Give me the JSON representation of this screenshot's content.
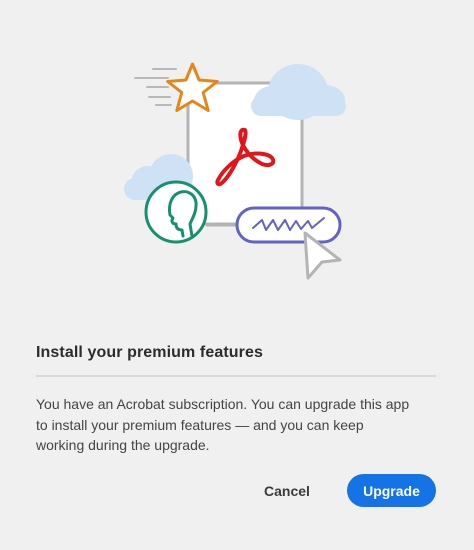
{
  "dialog": {
    "title": "Install your premium features",
    "body_lines": [
      "You have an Acrobat subscription. You can upgrade this app",
      "to install your premium features — and you can keep",
      "working during the upgrade."
    ],
    "cancel_label": "Cancel",
    "upgrade_label": "Upgrade"
  },
  "illustration": {
    "icons": [
      "star-icon",
      "cloud-icon",
      "acrobat-logo-icon",
      "profile-icon",
      "signature-field-icon",
      "cursor-icon"
    ]
  },
  "colors": {
    "background": "#f0f0f0",
    "accent": "#1473e6",
    "star": "#e68619",
    "acrobat_red": "#e0161b",
    "profile_green": "#15916e",
    "signature_purple": "#6262c9",
    "cloud": "#cfe1f5"
  }
}
